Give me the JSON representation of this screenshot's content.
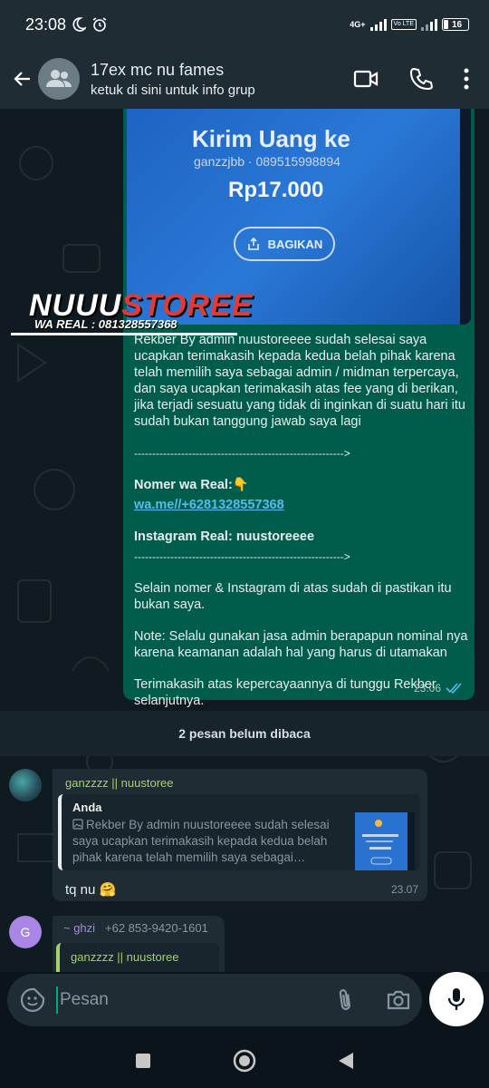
{
  "status_bar": {
    "time": "23:08",
    "network": "4G+",
    "volte": "Vo LTE",
    "battery": "16"
  },
  "header": {
    "title": "17ex mc nu fames",
    "subtitle": "ketuk di sini untuk info grup"
  },
  "sent_message": {
    "photo": {
      "title": "Kirim Uang ke",
      "name": "ganzzjbb · 089515998894",
      "amount": "Rp17.000",
      "share_label": "BAGIKAN"
    },
    "watermark": {
      "brand_white": "NUUU",
      "brand_red": "STOREE",
      "sub": "WA REAL : 081328557368"
    },
    "paragraph1": "Rekber By admin nuustoreeee sudah selesai saya ucapkan terimakasih kepada kedua belah pihak karena telah memilih saya sebagai admin / midman terpercaya, dan saya ucapkan terimakasih atas fee yang di berikan, jika terjadi sesuatu yang tidak di inginkan di suatu hari itu sudah bukan tanggung jawab saya lagi",
    "divider1": "---------------------------------------------------------->",
    "wa_label": "Nomer wa Real:👇",
    "wa_link": "wa.me//+6281328557368",
    "instagram": "Instagram Real: nuustoreeee",
    "divider2": "---------------------------------------------------------->",
    "paragraph2": "Selain nomer & Instagram di atas sudah di pastikan itu bukan saya.",
    "paragraph3": "Note: Selalu gunakan jasa admin berapapun nominal nya karena keamanan adalah hal yang harus di utamakan",
    "paragraph4": "Terimakasih atas kepercayaannya di tunggu Rekber selanjutnya.",
    "time": "23.06"
  },
  "unread_banner": "2 pesan belum dibaca",
  "received_1": {
    "sender": "ganzzzz || nuustoree",
    "quote_author": "Anda",
    "quote_text": "Rekber By admin nuustoreeee sudah selesai saya ucapkan terimakasih kepada kedua belah pihak karena telah memilih saya sebagai…",
    "message": "tq nu 🤗",
    "time": "23.07"
  },
  "received_2": {
    "avatar_letter": "G",
    "sender": "~ ghzi",
    "phone": "+62 853-9420-1601",
    "quote_name": "ganzzzz || nuustoree"
  },
  "input": {
    "placeholder": "Pesan"
  },
  "colors": {
    "header_bg": "#1f2c34",
    "sent_bubble": "#005c4b",
    "received_bubble": "#1f2c34",
    "link": "#53bdeb",
    "read_ticks": "#53bdeb"
  }
}
